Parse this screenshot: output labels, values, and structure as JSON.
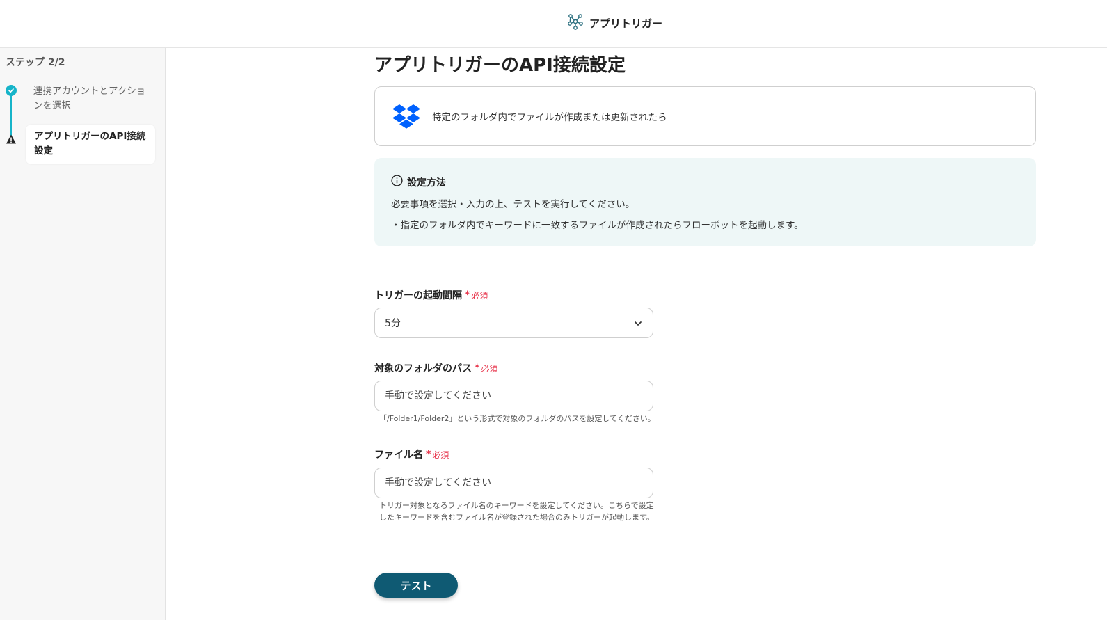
{
  "header": {
    "brand_icon": "yoom-network-logo-icon",
    "brand_name": "アプリトリガー"
  },
  "sidebar": {
    "step_counter": "ステップ 2/2",
    "steps": [
      {
        "label": "連携アカウントとアクションを選択",
        "status": "complete",
        "icon": "check-circle-icon"
      },
      {
        "label": "アプリトリガーのAPI接続設定",
        "status": "warning",
        "icon": "warning-triangle-icon"
      }
    ],
    "accent_color": "#16b4c9"
  },
  "main": {
    "title": "アプリトリガーのAPI接続設定",
    "trigger": {
      "app_icon": "dropbox-icon",
      "text": "特定のフォルダ内でファイルが作成または更新されたら"
    },
    "info": {
      "icon": "info-icon",
      "title": "設定方法",
      "line1": "必要事項を選択・入力の上、テストを実行してください。",
      "line2": "・指定のフォルダ内でキーワードに一致するファイルが作成されたらフローボットを起動します。"
    },
    "fields": {
      "interval": {
        "label": "トリガーの起動間隔",
        "required": "必須",
        "value": "5分"
      },
      "folder_path": {
        "label": "対象のフォルダのパス",
        "required": "必須",
        "placeholder": "手動で設定してください",
        "hint": "「/Folder1/Folder2」という形式で対象のフォルダのパスを設定してください。"
      },
      "file_name": {
        "label": "ファイル名",
        "required": "必須",
        "placeholder": "手動で設定してください",
        "hint": "トリガー対象となるファイル名のキーワードを設定してください。こちらで設定したキーワードを含むファイル名が登録された場合のみトリガーが起動します。"
      }
    },
    "test_button": "テスト",
    "primary_color": "#0f5a73",
    "required_color": "#e8384f"
  }
}
